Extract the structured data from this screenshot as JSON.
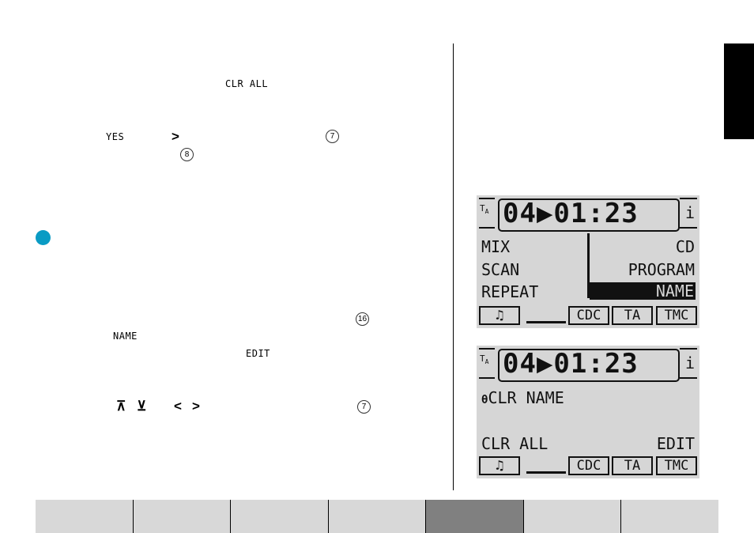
{
  "left_text": {
    "clr_all": "CLR ALL",
    "yes": "YES",
    "right_arrow_1": ">",
    "ref_7a": "7",
    "ref_8": "8",
    "ref_16": "16",
    "name": "NAME",
    "edit": "EDIT",
    "up_arrow": "⊼",
    "down_arrow": "⊻",
    "left_arrow": "<",
    "right_arrow_2": ">",
    "ref_7b": "7"
  },
  "colors": {
    "bullet": "#0a9bc4",
    "lcd_bg": "#d6d6d6",
    "footer_active": "#808080",
    "footer_inactive": "#d8d8d8"
  },
  "lcd1": {
    "ta": "T",
    "ta_sub": "A",
    "track_time": "04▶01:23",
    "info": "i",
    "left_items": [
      "MIX",
      "SCAN",
      "REPEAT"
    ],
    "right_items": [
      "CD",
      "PROGRAM"
    ],
    "selected": "NAME",
    "indicators": {
      "music": "♫",
      "cdc": "CDC",
      "ta": "TA",
      "tmc": "TMC"
    }
  },
  "lcd2": {
    "ta": "T",
    "ta_sub": "A",
    "track_time": "04▶01:23",
    "info": "i",
    "line1_prefix": "θ",
    "line1": "CLR NAME",
    "bottom_left": "CLR ALL",
    "bottom_right": "EDIT",
    "indicators": {
      "music": "♫",
      "cdc": "CDC",
      "ta": "TA",
      "tmc": "TMC"
    }
  },
  "footer": {
    "tabs": 7,
    "active_index": 4
  }
}
